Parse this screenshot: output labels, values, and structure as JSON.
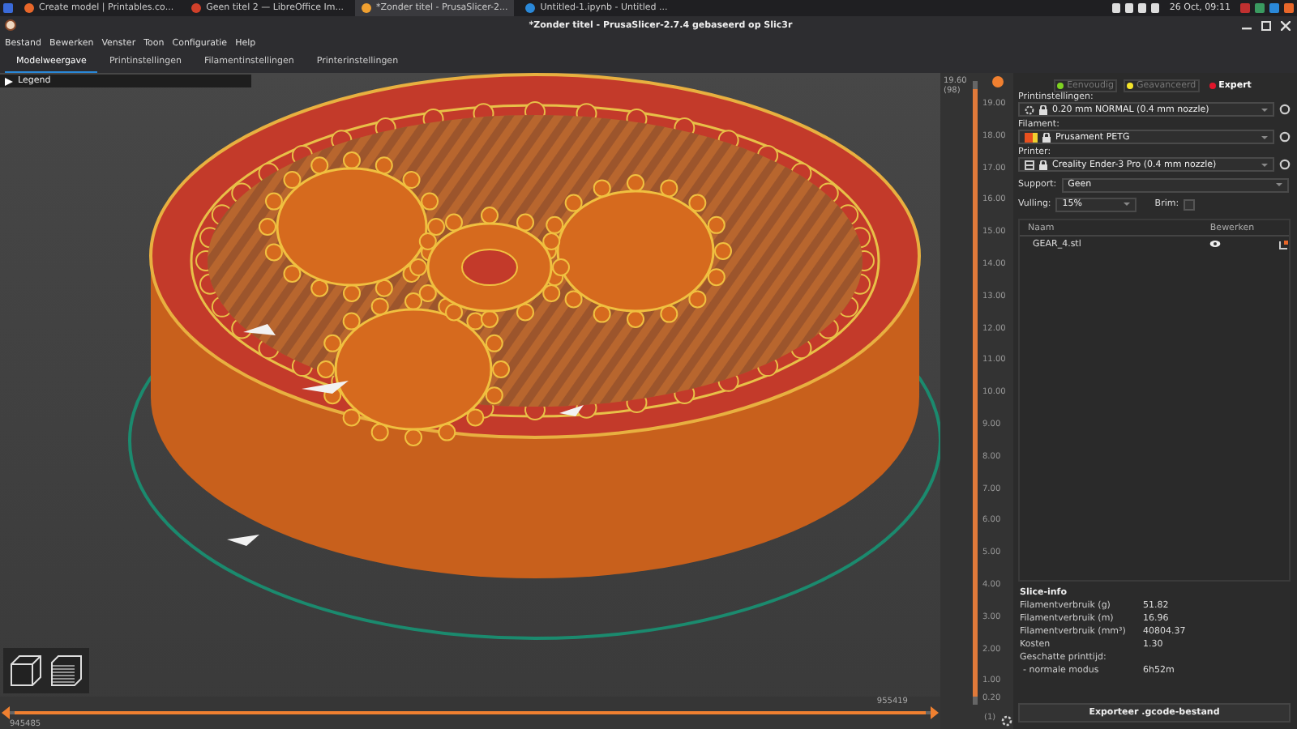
{
  "taskbar": {
    "windows": [
      {
        "label": "Create model | Printables.co...",
        "selected": false
      },
      {
        "label": "Geen titel 2 — LibreOffice Im...",
        "selected": false
      },
      {
        "label": "*Zonder titel - PrusaSlicer-2...",
        "selected": true
      },
      {
        "label": "Untitled-1.ipynb - Untitled ...",
        "selected": false
      }
    ],
    "clock": "26 Oct, 09:11"
  },
  "window": {
    "title": "*Zonder titel - PrusaSlicer-2.7.4 gebaseerd op Slic3r"
  },
  "menu": [
    "Bestand",
    "Bewerken",
    "Venster",
    "Toon",
    "Configuratie",
    "Help"
  ],
  "tabs": [
    {
      "label": "Modelweergave",
      "selected": true
    },
    {
      "label": "Printinstellingen",
      "selected": false
    },
    {
      "label": "Filamentinstellingen",
      "selected": false
    },
    {
      "label": "Printerinstellingen",
      "selected": false
    }
  ],
  "legend": {
    "label": "Legend",
    "expanded": false
  },
  "layer_slider": {
    "top_value": "19.60",
    "top_layer": "(98)",
    "level": 1,
    "ticks": [
      "19.00",
      "18.00",
      "17.00",
      "16.00",
      "15.00",
      "14.00",
      "13.00",
      "12.00",
      "11.00",
      "10.00",
      "9.00",
      "8.00",
      "7.00",
      "6.00",
      "5.00",
      "4.00",
      "3.00",
      "2.00",
      "1.00"
    ],
    "bottom_value": "0.20",
    "bottom_layer": "(1)"
  },
  "horizontal_slider": {
    "start": "945485",
    "end": "955419",
    "level": 1
  },
  "modes": [
    {
      "label": "Eenvoudig",
      "selected": false,
      "color": "#7ed321"
    },
    {
      "label": "Geavanceerd",
      "selected": false,
      "color": "#f5e52a"
    },
    {
      "label": "Expert",
      "selected": true,
      "color": "#e0162b"
    }
  ],
  "presets": [
    {
      "kind": "print",
      "label": "Printinstellingen:",
      "value": "0.20 mm NORMAL (0.4 mm nozzle)"
    },
    {
      "kind": "filament",
      "label": "Filament:",
      "value": "Prusament PETG"
    },
    {
      "kind": "printer",
      "label": "Printer:",
      "value": "Creality Ender-3 Pro (0.4 mm nozzle)"
    }
  ],
  "support": {
    "label": "Support:",
    "value": "Geen"
  },
  "infill": {
    "label": "Vulling:",
    "value": "15%"
  },
  "brim": {
    "label": "Brim:",
    "checked": false
  },
  "objects": {
    "columns": [
      "Naam",
      "Bewerken"
    ],
    "rows": [
      {
        "name": "GEAR_4.stl",
        "visible": true
      }
    ]
  },
  "slice_info": {
    "title": "Slice-info",
    "rows": [
      {
        "label": "Filamentverbruik (g)",
        "value": "51.82"
      },
      {
        "label": "Filamentverbruik (m)",
        "value": "16.96"
      },
      {
        "label": "Filamentverbruik (mm³)",
        "value": "40804.37"
      },
      {
        "label": "Kosten",
        "value": "1.30"
      }
    ],
    "time_label": "Geschatte printtijd:",
    "time_rows": [
      {
        "label": "- normale modus",
        "value": "6h52m"
      }
    ]
  },
  "export_button": "Exporteer .gcode-bestand"
}
